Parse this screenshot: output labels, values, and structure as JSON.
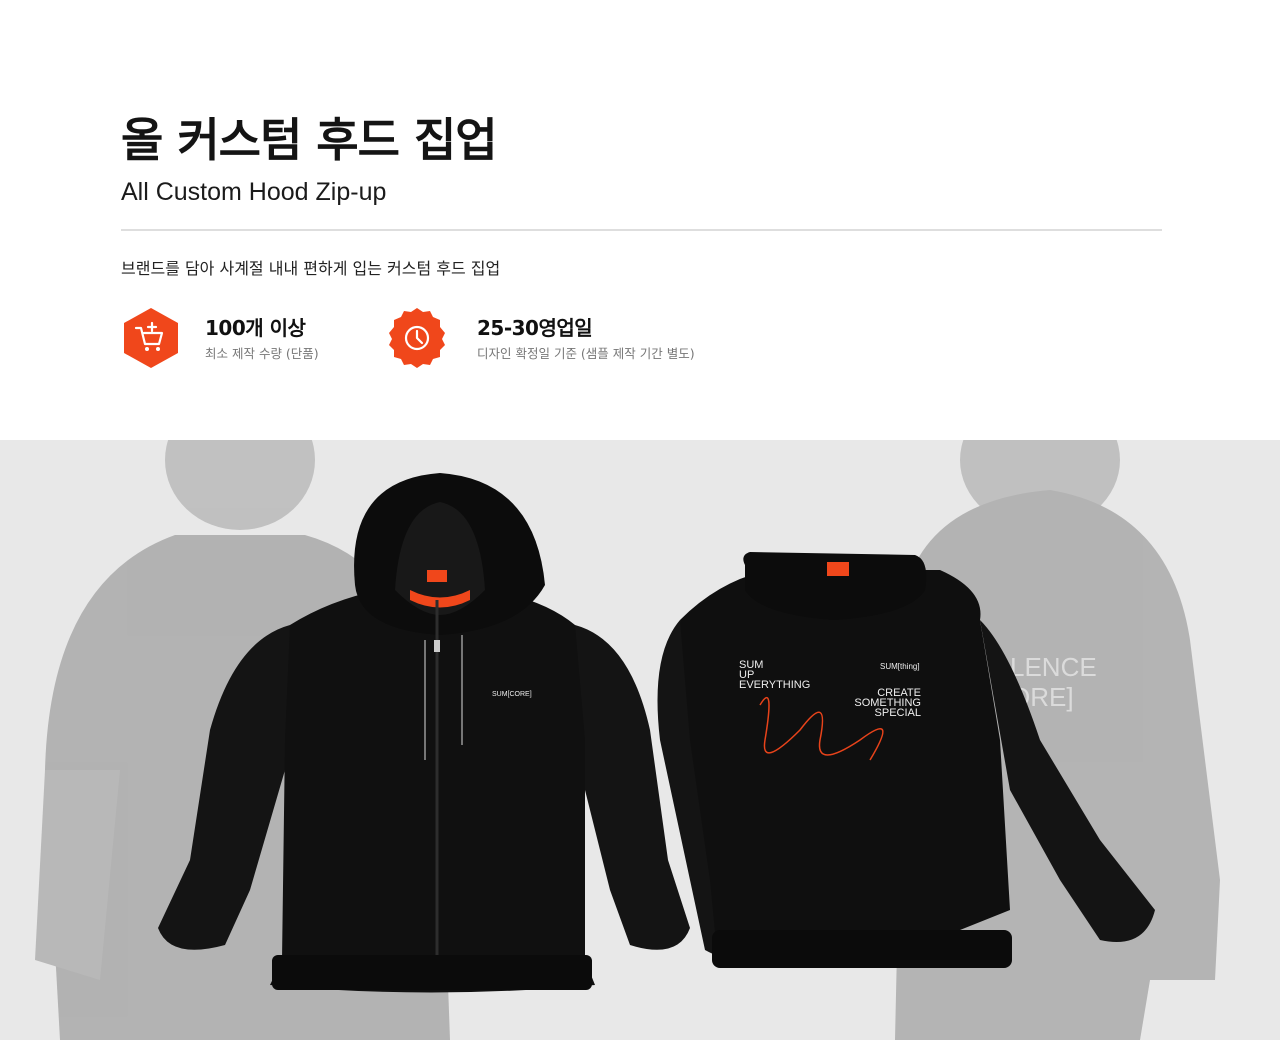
{
  "product": {
    "title_ko": "올 커스텀 후드 집업",
    "title_en": "All Custom Hood Zip-up",
    "description": "브랜드를 담아 사계절 내내 편하게 입는 커스텀 후드 집업"
  },
  "features": [
    {
      "icon": "cart-add-icon",
      "title": "100개 이상",
      "subtitle": "최소 제작 수량 (단품)"
    },
    {
      "icon": "clock-icon",
      "title": "25-30영업일",
      "subtitle": "디자인 확정일 기준 (샘플 제작 기간 별도)"
    }
  ],
  "colors": {
    "accent": "#f0471b",
    "hoodie": "#0f0f0f",
    "photo_bg": "#e8e8e8"
  },
  "image": {
    "front_logo": "SUM[CORE]",
    "back_left": [
      "SUM",
      "UP",
      "EVERYTHING"
    ],
    "back_logo": "SUM[thing]",
    "back_right": [
      "CREATE",
      "SOMETHING",
      "SPECIAL"
    ],
    "bg_right_text": [
      "LENCE",
      "ORE]"
    ]
  }
}
